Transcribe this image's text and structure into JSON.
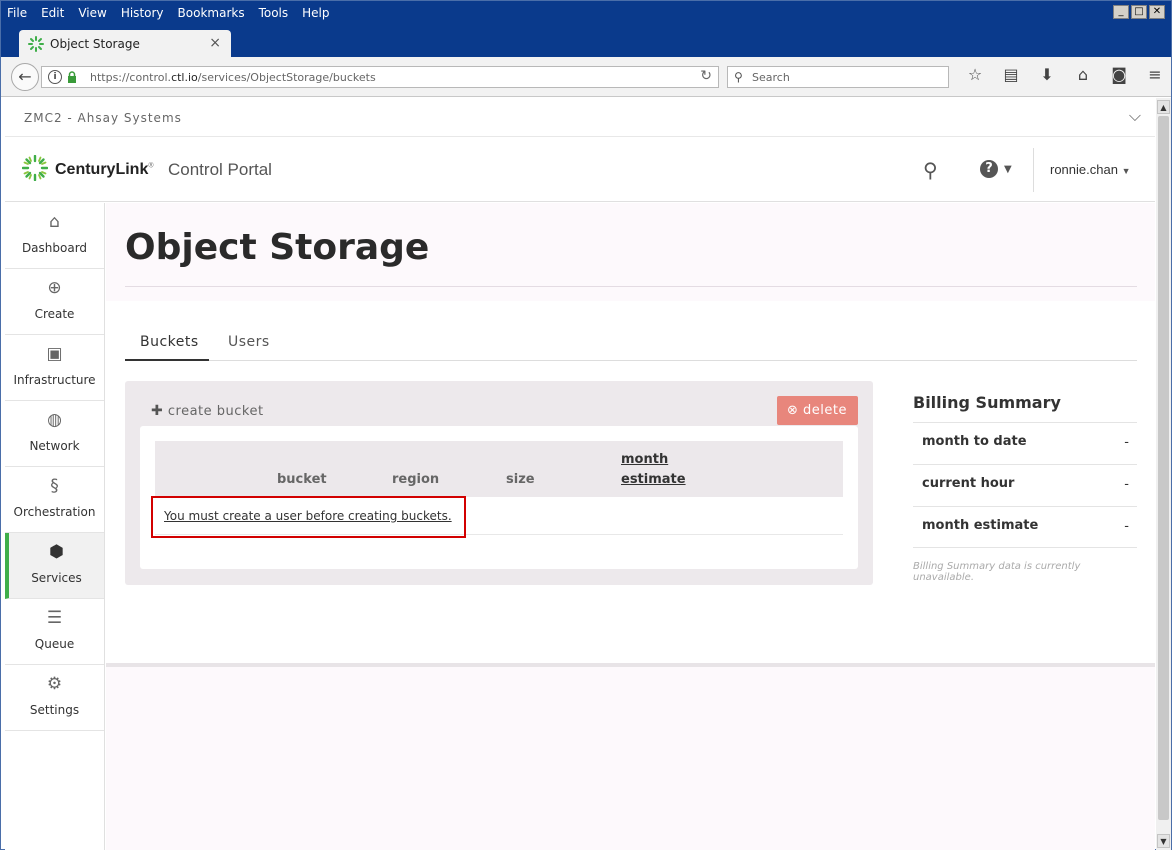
{
  "browser": {
    "menu": [
      "File",
      "Edit",
      "View",
      "History",
      "Bookmarks",
      "Tools",
      "Help"
    ],
    "tab_title": "Object Storage",
    "url_prefix": "https://control.",
    "url_domain": "ctl.io",
    "url_path": "/services/ObjectStorage/buckets",
    "search_placeholder": "Search"
  },
  "org": {
    "name": "ZMC2 - Ahsay Systems"
  },
  "header": {
    "brand_bold": "CenturyLink",
    "brand_mark": "®",
    "portal": "Control Portal",
    "user": "ronnie.chan"
  },
  "sidebar": {
    "items": [
      {
        "label": "Dashboard",
        "icon": "home-icon"
      },
      {
        "label": "Create",
        "icon": "plus-circle-icon"
      },
      {
        "label": "Infrastructure",
        "icon": "chip-icon"
      },
      {
        "label": "Network",
        "icon": "globe-icon"
      },
      {
        "label": "Orchestration",
        "icon": "orchestration-icon"
      },
      {
        "label": "Services",
        "icon": "cube-icon",
        "active": true
      },
      {
        "label": "Queue",
        "icon": "queue-icon"
      },
      {
        "label": "Settings",
        "icon": "gear-icon"
      }
    ]
  },
  "main": {
    "title": "Object Storage",
    "tabs": [
      {
        "label": "Buckets",
        "active": true
      },
      {
        "label": "Users"
      }
    ],
    "create_bucket": "create bucket",
    "delete": "delete",
    "columns": {
      "bucket": "bucket",
      "region": "region",
      "size": "size",
      "month": "month",
      "estimate": "estimate"
    },
    "message": "You must create a user before creating buckets."
  },
  "billing": {
    "title": "Billing Summary",
    "rows": [
      {
        "label": "month to date",
        "value": "-"
      },
      {
        "label": "current hour",
        "value": "-"
      },
      {
        "label": "month estimate",
        "value": "-"
      }
    ],
    "note": "Billing Summary data is currently unavailable."
  },
  "colors": {
    "accent_green": "#3fae49",
    "delete_red": "#e8867c",
    "highlight_red": "#d20000"
  }
}
